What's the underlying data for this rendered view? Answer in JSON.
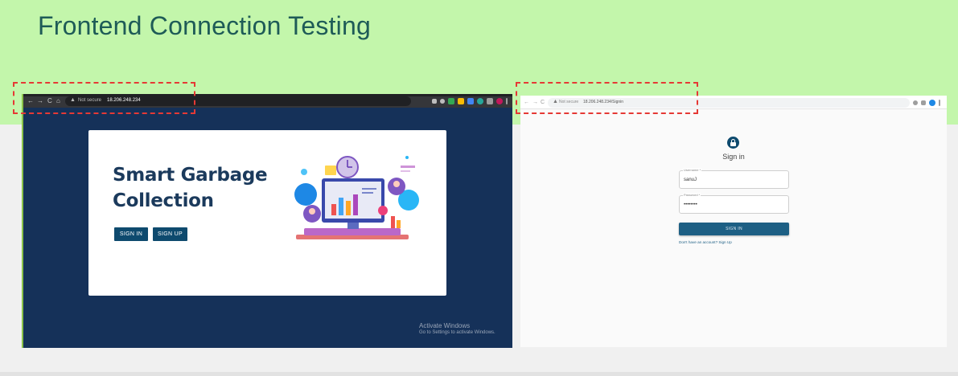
{
  "slide": {
    "title": "Frontend Connection Testing"
  },
  "left_browser": {
    "nav": {
      "back": "←",
      "forward": "→",
      "reload": "C",
      "home": "⌂"
    },
    "security_warning": "▲",
    "security_label": "Not secure",
    "url": "18.206.248.234",
    "card": {
      "title_line1": "Smart Garbage",
      "title_line2": "Collection",
      "signin_label": "SIGN IN",
      "signup_label": "SIGN UP",
      "illustration_icon": "dashboard-illustration"
    },
    "watermark": {
      "line1": "Activate Windows",
      "line2": "Go to Settings to activate Windows."
    }
  },
  "right_browser": {
    "nav": {
      "back": "←",
      "forward": "→",
      "reload": "C"
    },
    "security_warning": "▲",
    "security_label": "Not secure",
    "url": "18.206.248.234/Signin",
    "page": {
      "title": "Sign in",
      "username_label": "Username *",
      "username_value": "sanuJ",
      "password_label": "Password *",
      "password_value": "••••••••",
      "signin_button": "SIGN IN",
      "signup_link": "Don't have an account? Sign Up"
    }
  },
  "colors": {
    "banner": "#c3f6ab",
    "title": "#1e5b57",
    "highlight": "#e53935",
    "accent": "#0e4a6e"
  }
}
